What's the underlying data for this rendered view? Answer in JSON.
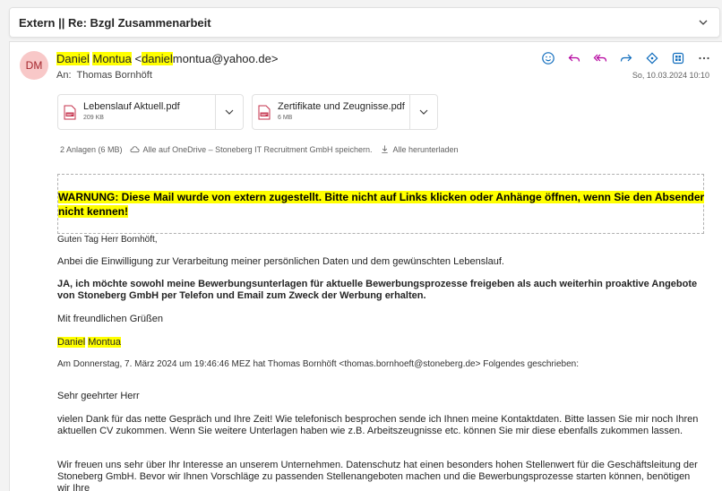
{
  "subject": "Extern || Re: Bzgl Zusammenarbeit",
  "sender": {
    "initials": "DM",
    "first": "Daniel",
    "last": "Montua",
    "email_prefix": "daniel",
    "email_rest": "montua@yahoo.de>",
    "email_open": "<"
  },
  "to_label": "An:",
  "to_name": "Thomas Bornhöft",
  "date": "So, 10.03.2024 10:10",
  "attachments": [
    {
      "name": "Lebenslauf Aktuell.pdf",
      "size": "209 KB"
    },
    {
      "name": "Zertifikate und Zeugnisse.pdf",
      "size": "6 MB"
    }
  ],
  "attachments_summary": {
    "count": "2 Anlagen (6 MB)",
    "save_onedrive": "Alle auf OneDrive – Stoneberg IT Recruitment GmbH speichern.",
    "download_all": "Alle herunterladen"
  },
  "warning": {
    "label": "WARNUNG:",
    "text": " Diese Mail wurde von extern zugestellt. Bitte nicht auf Links klicken oder Anhänge öffnen, wenn Sie den Absender nicht kennen!"
  },
  "body": {
    "greeting": "Guten Tag Herr Bornhöft,",
    "line1": "Anbei die Einwilligung zur Verarbeitung meiner persönlichen Daten und dem gewünschten Lebenslauf.",
    "consent": "JA, ich möchte sowohl meine Bewerbungsunterlagen für aktuelle Bewerbungsprozesse freigeben als auch weiterhin proaktive Angebote von Stoneberg GmbH per Telefon und Email zum Zweck der Werbung erhalten.",
    "closing": "Mit freundlichen Grüßen",
    "sig_first": "Daniel",
    "sig_last": "Montua",
    "quote_header": "Am Donnerstag, 7. März 2024 um 19:46:46 MEZ hat Thomas Bornhöft <thomas.bornhoeft@stoneberg.de> Folgendes geschrieben:",
    "quote_salutation": "Sehr geehrter Herr",
    "quote_p1": "vielen Dank für das nette Gespräch und Ihre Zeit! Wie telefonisch besprochen sende ich Ihnen meine Kontaktdaten. Bitte lassen Sie mir noch Ihren aktuellen CV zukommen. Wenn Sie weitere Unterlagen haben wie z.B. Arbeitszeugnisse etc. können Sie mir diese ebenfalls zukommen lassen.",
    "quote_p2": "Wir freuen uns sehr über Ihr Interesse an unserem Unternehmen. Datenschutz hat einen besonders hohen Stellenwert für die Geschäftsleitung der Stoneberg GmbH. Bevor wir Ihnen Vorschläge zu passenden Stellenangeboten machen und die Bewerbungsprozesse starten können, benötigen wir Ihre"
  },
  "colors": {
    "highlight": "#ffff00",
    "warning_red": "#e00000",
    "accent": "#0f6cbd",
    "avatar_bg": "#f8c8c8"
  },
  "icons": [
    "emoji-icon",
    "reply-icon",
    "reply-all-icon",
    "forward-icon",
    "apps-icon",
    "teams-icon",
    "more-icon",
    "chevron-down-icon",
    "pdf-icon",
    "cloud-icon",
    "download-icon"
  ]
}
